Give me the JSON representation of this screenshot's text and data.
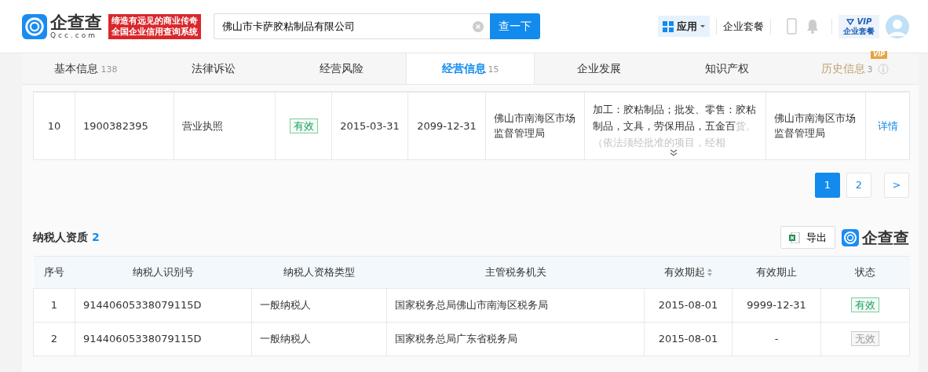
{
  "header": {
    "logo_name": "企查查",
    "logo_domain": "Qcc.com",
    "slogan": [
      "缔造有远见的商业传奇",
      "全国企业信用查询系统"
    ],
    "search": {
      "value": "佛山市卡萨胶粘制品有限公司",
      "button": "查一下"
    },
    "apps_button": "应用",
    "package_link": "企业套餐",
    "vip_badge": {
      "tag": "VIP",
      "label": "企业套餐"
    }
  },
  "tabs": [
    {
      "label": "基本信息",
      "count": "138",
      "selected": false,
      "vip": false
    },
    {
      "label": "法律诉讼",
      "selected": false,
      "vip": false
    },
    {
      "label": "经营风险",
      "selected": false,
      "vip": false
    },
    {
      "label": "经营信息",
      "count": "15",
      "selected": true,
      "vip": false
    },
    {
      "label": "企业发展",
      "selected": false,
      "vip": false
    },
    {
      "label": "知识产权",
      "selected": false,
      "vip": false
    },
    {
      "label": "历史信息",
      "count": "3",
      "selected": false,
      "vip": true,
      "vip_tag": "VIP"
    }
  ],
  "license_table": {
    "rows": [
      {
        "no": "10",
        "number": "1900382395",
        "type": "营业执照",
        "status": {
          "label": "有效",
          "kind": "valid"
        },
        "start": "2015-03-31",
        "end": "2099-12-31",
        "authority": "佛山市南海区市场监督管理局",
        "scope": "加工：胶粘制品；批发、零售：胶粘制品，文具，劳保用品，五金百",
        "scope_faded": "货。（依法须经批准的项目，经相",
        "issuer": "佛山市南海区市场监督管理局",
        "details": "详情"
      }
    ]
  },
  "pagination": {
    "pages": [
      {
        "label": "1",
        "selected": true
      },
      {
        "label": "2",
        "selected": false
      }
    ],
    "next": ">"
  },
  "tax_section": {
    "title": "纳税人资质",
    "count": "2",
    "export": "导出",
    "brand": "企查查",
    "columns": [
      {
        "label": "序号",
        "sortable": false
      },
      {
        "label": "纳税人识别号",
        "sortable": false
      },
      {
        "label": "纳税人资格类型",
        "sortable": false
      },
      {
        "label": "主管税务机关",
        "sortable": false
      },
      {
        "label": "有效期起",
        "sortable": true
      },
      {
        "label": "有效期止",
        "sortable": false
      },
      {
        "label": "状态",
        "sortable": false
      }
    ],
    "rows": [
      {
        "no": "1",
        "tax_id": "91440605338079115D",
        "type": "一般纳税人",
        "authority": "国家税务总局佛山市南海区税务局",
        "start": "2015-08-01",
        "end": "9999-12-31",
        "status": {
          "label": "有效",
          "kind": "valid"
        }
      },
      {
        "no": "2",
        "tax_id": "91440605338079115D",
        "type": "一般纳税人",
        "authority": "国家税务总局广东省税务局",
        "start": "2015-08-01",
        "end": "-",
        "status": {
          "label": "无效",
          "kind": "invalid"
        }
      }
    ]
  }
}
